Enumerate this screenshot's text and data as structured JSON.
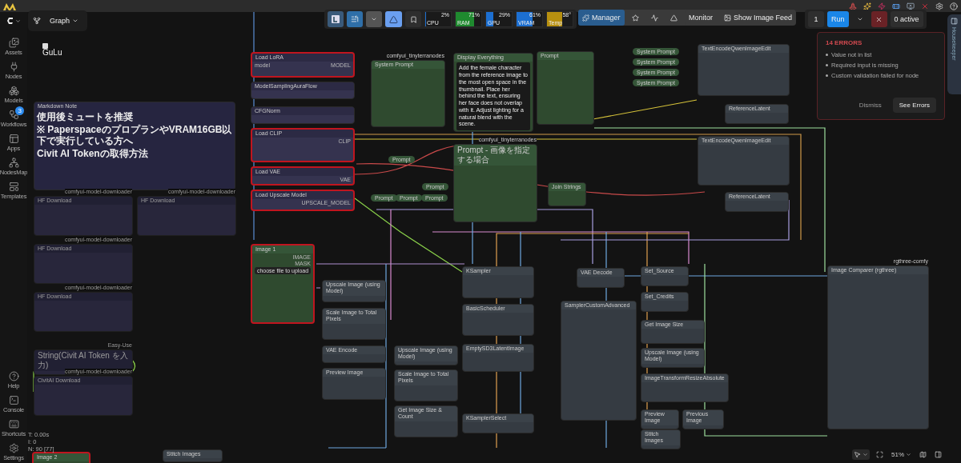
{
  "graph_tab": {
    "label": "Graph"
  },
  "sidebar": {
    "items": [
      {
        "label": "Assets"
      },
      {
        "label": "Nodes"
      },
      {
        "label": "Models"
      },
      {
        "label": "Workflows",
        "badge": "3"
      },
      {
        "label": "Apps"
      },
      {
        "label": "NodesMap"
      },
      {
        "label": "Templates"
      }
    ],
    "bottom_items": [
      {
        "label": "Help"
      },
      {
        "label": "Console"
      },
      {
        "label": "Shortcuts"
      },
      {
        "label": "Settings"
      }
    ]
  },
  "toolbar": {
    "monitors": [
      {
        "label": "CPU",
        "reading": "2%",
        "level": 0.02,
        "color": "#1c6fd1"
      },
      {
        "label": "RAM",
        "reading": "71%",
        "level": 0.71,
        "color": "#1f8a2f"
      },
      {
        "label": "GPU",
        "reading": "29%",
        "level": 0.29,
        "color": "#1c6fd1"
      },
      {
        "label": "VRAM",
        "reading": "61%",
        "level": 0.61,
        "color": "#1c6fd1"
      },
      {
        "label": "Temp",
        "reading": "58°",
        "level": 0.58,
        "color": "#b8900f"
      }
    ],
    "manager": "Manager",
    "monitor": "Monitor",
    "image_feed": "Show Image Feed",
    "queue_count": "1",
    "run": "Run",
    "active": "0 active"
  },
  "errors": {
    "title": "14 ERRORS",
    "items": [
      "Value not in list",
      "Required input is missing",
      "Custom validation failed for node"
    ],
    "dismiss": "Dismiss",
    "see": "See Errors"
  },
  "side_tab": "Housekeeper",
  "stats": [
    "T: 0.00s",
    "I: 0",
    "N: 90 [77]"
  ],
  "zoom": "51%",
  "logo_text": "GuLu",
  "nodes": [
    {
      "title": "Markdown Note",
      "kind": "note",
      "error": false,
      "muted": false,
      "rows": [
        {
          "kind": "heading",
          "label": "使用後ミュートを推奨"
        },
        {
          "kind": "heading",
          "label": "※ PaperspaceのプロプランやVRAM16GB以下で実行している方へ"
        },
        {
          "kind": "heading",
          "label": "Civit AI Tokenの取得方法"
        }
      ]
    },
    {
      "title": "HF Download",
      "kind": "loader",
      "error": false,
      "muted": true,
      "badge": "comfyui-model-downloader"
    },
    {
      "title": "HF Download",
      "kind": "loader",
      "error": false,
      "muted": true,
      "badge": "comfyui-model-downloader"
    },
    {
      "title": "HF Download",
      "kind": "loader",
      "error": false,
      "muted": true,
      "badge": "comfyui-model-downloader"
    },
    {
      "title": "HF Download",
      "kind": "loader",
      "error": false,
      "muted": true,
      "badge": "comfyui-model-downloader"
    },
    {
      "title": "String(Civit AI Token を入力)",
      "kind": "loader",
      "error": false,
      "muted": true,
      "badge": "Easy-Use"
    },
    {
      "title": "CivitAI Download",
      "kind": "loader",
      "error": false,
      "muted": true,
      "badge": "comfyui-model-downloader"
    },
    {
      "title": "Load LoRA",
      "kind": "loader",
      "error": true,
      "muted": false,
      "rows": [
        {
          "kind": "slot",
          "label": "model",
          "value": "MODEL"
        }
      ]
    },
    {
      "title": "ModelSamplingAuraFlow",
      "kind": "loader",
      "error": false,
      "muted": false
    },
    {
      "title": "CFGNorm",
      "kind": "loader",
      "error": false,
      "muted": false
    },
    {
      "title": "Load CLIP",
      "kind": "loader",
      "error": true,
      "muted": false,
      "rows": [
        {
          "kind": "slot",
          "label": "",
          "value": "CLIP"
        }
      ]
    },
    {
      "title": "Load VAE",
      "kind": "loader",
      "error": true,
      "muted": false,
      "rows": [
        {
          "kind": "slot",
          "label": "",
          "value": "VAE"
        }
      ]
    },
    {
      "title": "Load Upscale Model",
      "kind": "loader",
      "error": true,
      "muted": false,
      "rows": [
        {
          "kind": "slot",
          "label": "",
          "value": "UPSCALE_MODEL"
        }
      ]
    },
    {
      "title": "Image 1",
      "kind": "image",
      "error": true,
      "muted": false,
      "rows": [
        {
          "kind": "slot",
          "label": "",
          "value": "IMAGE"
        },
        {
          "kind": "slot",
          "label": "",
          "value": "MASK"
        },
        {
          "kind": "button",
          "label": "choose file to upload"
        }
      ]
    },
    {
      "title": "System Prompt",
      "kind": "image",
      "error": false,
      "muted": false,
      "badge": "comfyui_tinyterranodes"
    },
    {
      "title": "Display Everything",
      "kind": "image",
      "error": false,
      "muted": false,
      "rows": [
        {
          "kind": "text",
          "label": "Add the female character from the reference image to the most open space in the thumbnail. Place her behind the text, ensuring her face does not overlap with it. Adjust lighting for a natural blend with the scene."
        }
      ]
    },
    {
      "title": "Prompt",
      "kind": "image",
      "error": false,
      "muted": false
    },
    {
      "title": "Prompt - 画像を指定する場合",
      "kind": "image",
      "error": false,
      "muted": false,
      "badge": "comfyui_tinyterranodes"
    },
    {
      "title": "Upscale Image (using Model)",
      "kind": "plain",
      "error": false,
      "muted": false
    },
    {
      "title": "Scale Image to Total Pixels",
      "kind": "plain",
      "error": false,
      "muted": false
    },
    {
      "title": "VAE Encode",
      "kind": "plain",
      "error": false,
      "muted": false
    },
    {
      "title": "Preview Image",
      "kind": "plain",
      "error": false,
      "muted": false
    },
    {
      "title": "Upscale Image (using Model)",
      "kind": "plain",
      "error": false,
      "muted": false
    },
    {
      "title": "Scale Image to Total Pixels",
      "kind": "plain",
      "error": false,
      "muted": false
    },
    {
      "title": "Get Image Size & Count",
      "kind": "plain",
      "error": false,
      "muted": false
    },
    {
      "title": "KSampler",
      "kind": "plain",
      "error": false,
      "muted": false
    },
    {
      "title": "BasicScheduler",
      "kind": "plain",
      "error": false,
      "muted": false
    },
    {
      "title": "EmptySD3LatentImage",
      "kind": "plain",
      "error": false,
      "muted": false
    },
    {
      "title": "KSamplerSelect",
      "kind": "plain",
      "error": false,
      "muted": false
    },
    {
      "title": "VAE Decode",
      "kind": "plain",
      "error": false,
      "muted": false
    },
    {
      "title": "SamplerCustomAdvanced",
      "kind": "plain",
      "error": false,
      "muted": false
    },
    {
      "title": "TextEncodeQwenImageEdit",
      "kind": "plain",
      "error": false,
      "muted": false
    },
    {
      "title": "ReferenceLatent",
      "kind": "plain",
      "error": false,
      "muted": false
    },
    {
      "title": "TextEncodeQwenImageEdit",
      "kind": "plain",
      "error": false,
      "muted": false
    },
    {
      "title": "ReferenceLatent",
      "kind": "plain",
      "error": false,
      "muted": false
    },
    {
      "title": "Set_Source",
      "kind": "plain",
      "error": false,
      "muted": false
    },
    {
      "title": "Set_Credits",
      "kind": "plain",
      "error": false,
      "muted": false
    },
    {
      "title": "Get Image Size",
      "kind": "plain",
      "error": false,
      "muted": false
    },
    {
      "title": "Upscale Image (using Model)",
      "kind": "plain",
      "error": false,
      "muted": false
    },
    {
      "title": "ImageTransformResizeAbsolute",
      "kind": "plain",
      "error": false,
      "muted": false
    },
    {
      "title": "Preview Image",
      "kind": "plain",
      "error": false,
      "muted": false
    },
    {
      "title": "Previous Image",
      "kind": "plain",
      "error": false,
      "muted": false
    },
    {
      "title": "Stitch Images",
      "kind": "plain",
      "error": false,
      "muted": false
    },
    {
      "title": "Image Comparer (rgthree)",
      "kind": "plain",
      "error": false,
      "muted": false,
      "badge": "rgthree-comfy"
    },
    {
      "title": "Join Strings",
      "kind": "image",
      "error": false,
      "muted": false
    },
    {
      "title": "Image 2",
      "kind": "image",
      "error": true,
      "muted": false
    },
    {
      "title": "Stitch Images",
      "kind": "plain",
      "error": false,
      "muted": false
    }
  ],
  "collapsed": [
    {
      "title": "Prompt"
    },
    {
      "title": "Prompt"
    },
    {
      "title": "Prompt"
    },
    {
      "title": "Prompt"
    },
    {
      "title": "Prompt"
    },
    {
      "title": "System Prompt"
    },
    {
      "title": "System Prompt"
    },
    {
      "title": "System Prompt"
    },
    {
      "title": "System Prompt"
    }
  ]
}
